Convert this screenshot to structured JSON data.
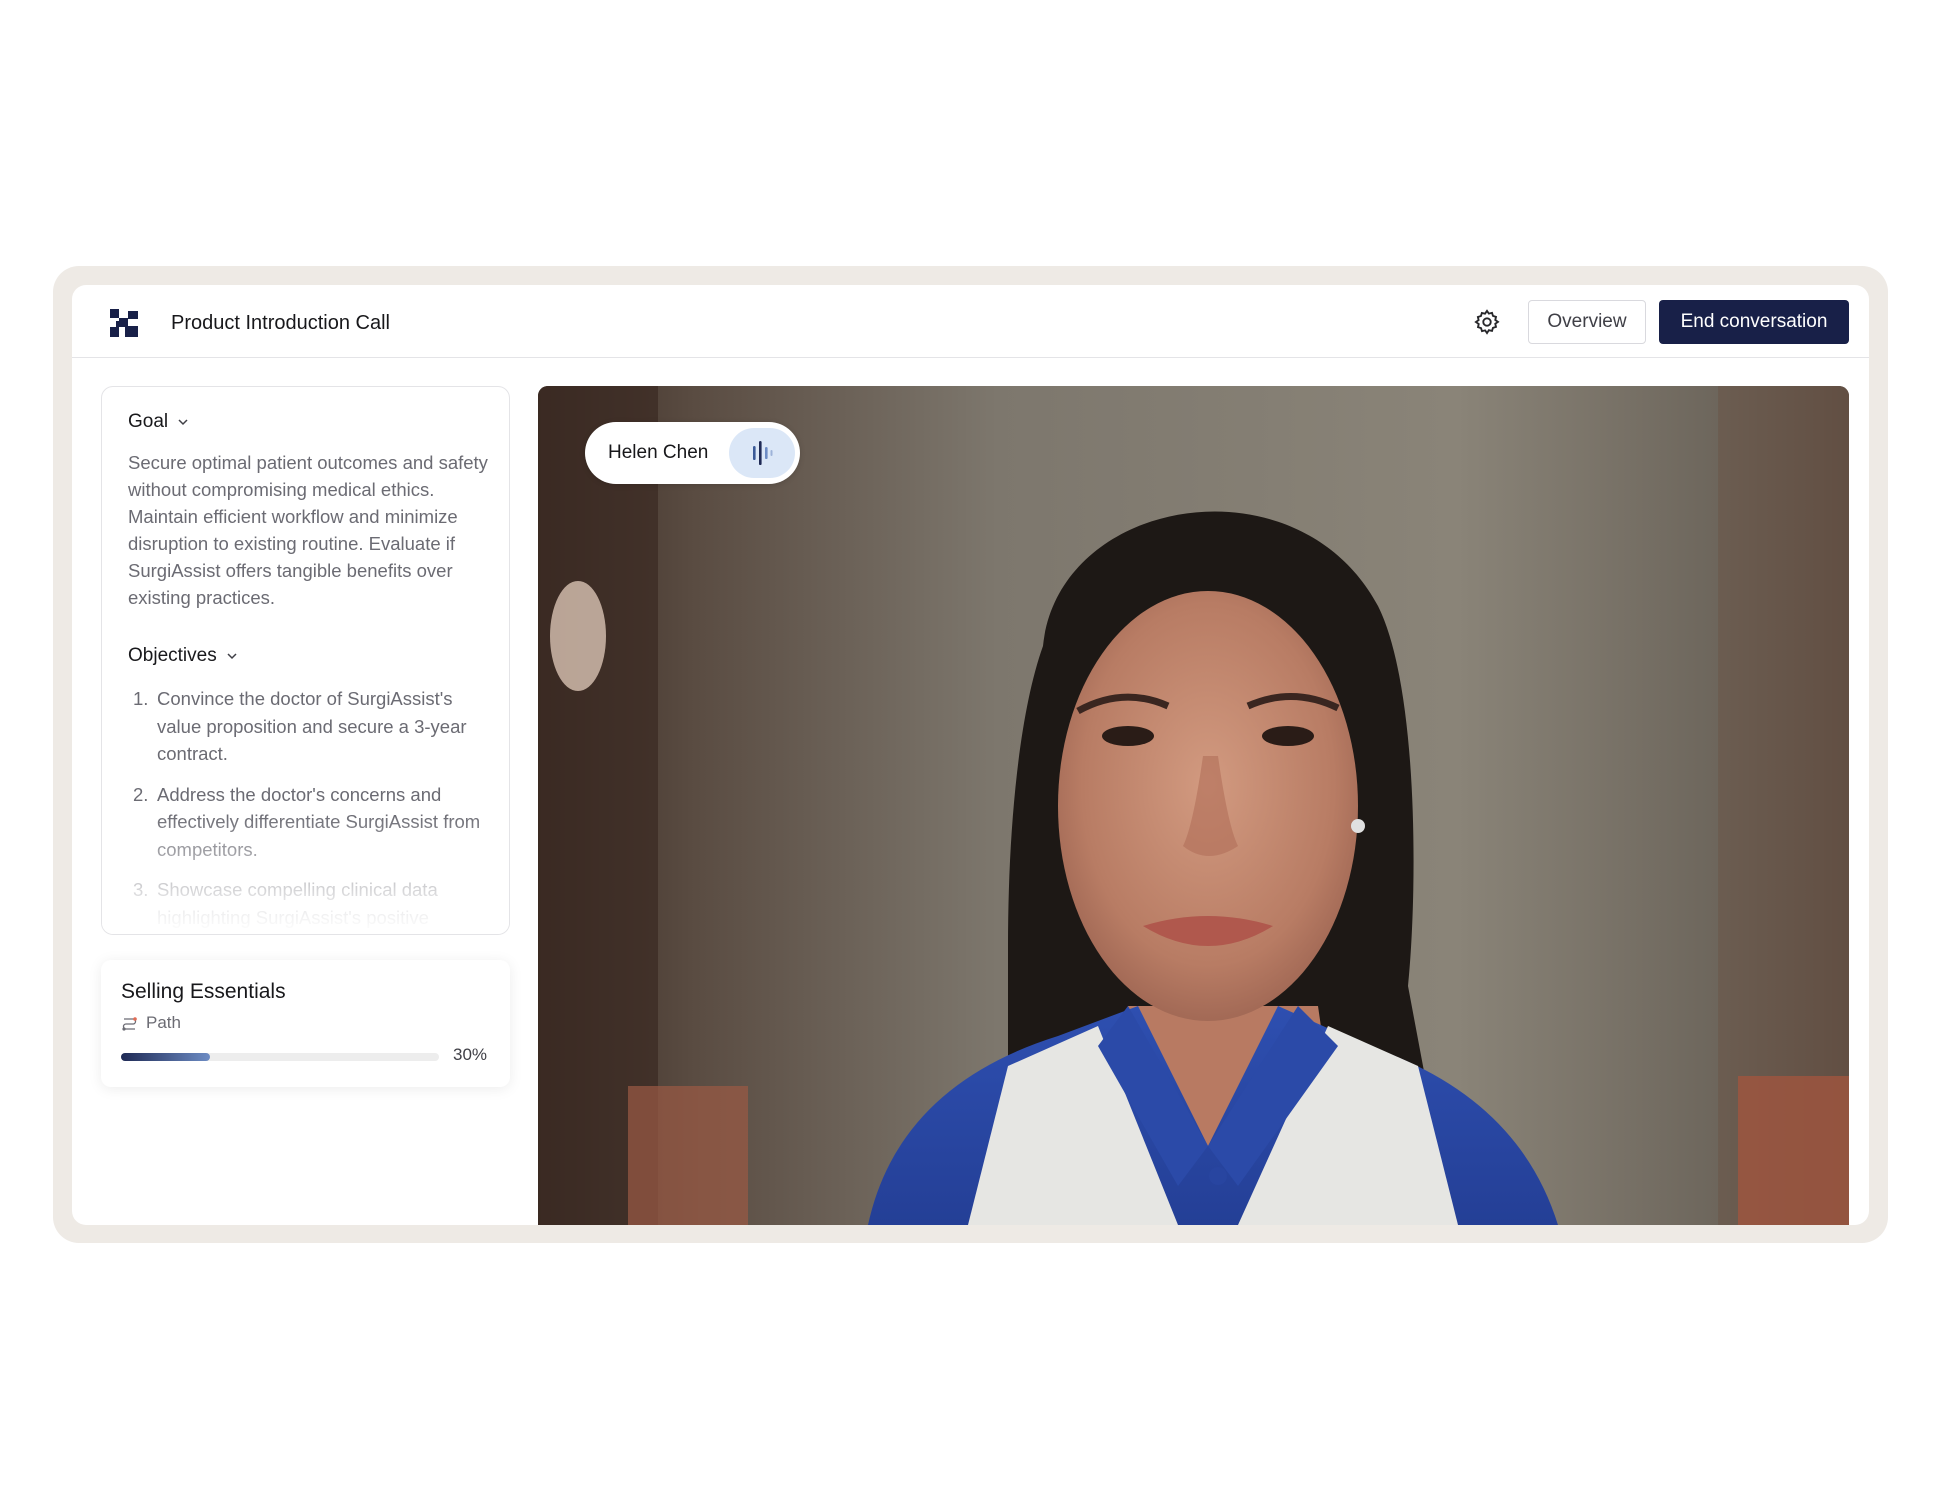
{
  "header": {
    "title": "Product Introduction Call",
    "overview_label": "Overview",
    "end_label": "End conversation"
  },
  "goal": {
    "heading": "Goal",
    "text": "Secure optimal patient outcomes and safety without compromising medical ethics. Maintain efficient workflow and minimize disruption to existing routine. Evaluate if SurgiAssist offers tangible benefits over existing practices."
  },
  "objectives": {
    "heading": "Objectives",
    "items": [
      {
        "num": "1.",
        "text": "Convince the doctor of SurgiAssist's value proposition and secure a 3-year contract."
      },
      {
        "num": "2.",
        "text": "Address the doctor's concerns and effectively differentiate SurgiAssist from competitors."
      },
      {
        "num": "3.",
        "text": "Showcase compelling clinical data highlighting SurgiAssist's positive"
      }
    ]
  },
  "selling": {
    "title": "Selling Essentials",
    "path_label": "Path",
    "progress_text": "30%",
    "progress_value": 0.28
  },
  "video": {
    "speaker_name": "Helen Chen"
  },
  "colors": {
    "primary": "#182048",
    "frame": "#eeeae5",
    "wave_bg": "#dbe7f7"
  },
  "icons": [
    "logo-icon",
    "gear-icon",
    "chevron-down-icon",
    "path-icon",
    "audio-wave-icon"
  ]
}
